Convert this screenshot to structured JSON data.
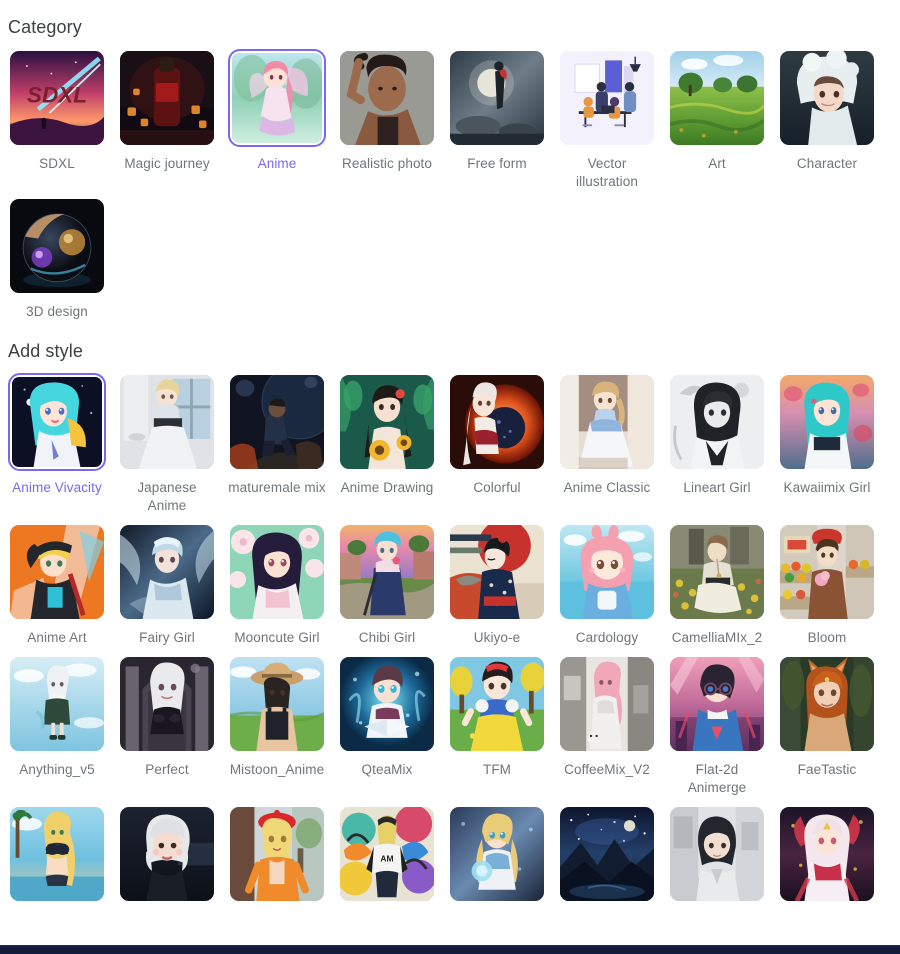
{
  "sections": {
    "category": {
      "title": "Category",
      "items": [
        {
          "label": "SDXL",
          "selected": false,
          "art": "sdxl"
        },
        {
          "label": "Magic journey",
          "selected": false,
          "art": "magic"
        },
        {
          "label": "Anime",
          "selected": true,
          "art": "anime-fairy"
        },
        {
          "label": "Realistic photo",
          "selected": false,
          "art": "realistic-portrait"
        },
        {
          "label": "Free form",
          "selected": false,
          "art": "freeform"
        },
        {
          "label": "Vector illustration",
          "selected": false,
          "art": "vector-office"
        },
        {
          "label": "Art",
          "selected": false,
          "art": "art-landscape"
        },
        {
          "label": "Character",
          "selected": false,
          "art": "character-hood"
        },
        {
          "label": "3D design",
          "selected": false,
          "art": "threed-orb"
        }
      ]
    },
    "add_style": {
      "title": "Add style",
      "items": [
        {
          "label": "Anime Vivacity",
          "selected": true,
          "art": "cyan-girl"
        },
        {
          "label": "Japanese Anime",
          "selected": false,
          "art": "window-dress"
        },
        {
          "label": "maturemale mix",
          "selected": false,
          "art": "space-man"
        },
        {
          "label": "Anime Drawing",
          "selected": false,
          "art": "sunflower-girl"
        },
        {
          "label": "Colorful",
          "selected": false,
          "art": "fire-orb"
        },
        {
          "label": "Anime Classic",
          "selected": false,
          "art": "blue-dress"
        },
        {
          "label": "Lineart Girl",
          "selected": false,
          "art": "mono-line"
        },
        {
          "label": "Kawaiimix Girl",
          "selected": false,
          "art": "kawaii-teal"
        },
        {
          "label": "Anime Art",
          "selected": false,
          "art": "orange-pop"
        },
        {
          "label": "Fairy Girl",
          "selected": false,
          "art": "icy-fairy"
        },
        {
          "label": "Mooncute Girl",
          "selected": false,
          "art": "blossom-girl"
        },
        {
          "label": "Chibi Girl",
          "selected": false,
          "art": "sunset-town"
        },
        {
          "label": "Ukiyo-e",
          "selected": false,
          "art": "ukiyo"
        },
        {
          "label": "Cardology",
          "selected": false,
          "art": "bunny-hoodie"
        },
        {
          "label": "CamelliaMIx_2",
          "selected": false,
          "art": "garden-sit"
        },
        {
          "label": "Bloom",
          "selected": false,
          "art": "market-girl"
        },
        {
          "label": "Anything_v5",
          "selected": false,
          "art": "sky-walk"
        },
        {
          "label": "Perfect",
          "selected": false,
          "art": "gothic-arch"
        },
        {
          "label": "Mistoon_Anime",
          "selected": false,
          "art": "hat-field"
        },
        {
          "label": "QteaMix",
          "selected": false,
          "art": "magic-book"
        },
        {
          "label": "TFM",
          "selected": false,
          "art": "snow-white"
        },
        {
          "label": "CoffeeMix_V2",
          "selected": false,
          "art": "pink-hall"
        },
        {
          "label": "Flat-2d Animerge",
          "selected": false,
          "art": "glasses-girl"
        },
        {
          "label": "FaeTastic",
          "selected": false,
          "art": "fox-fae"
        },
        {
          "label": "",
          "selected": false,
          "art": "beach-blonde"
        },
        {
          "label": "",
          "selected": false,
          "art": "silver-bob"
        },
        {
          "label": "",
          "selected": false,
          "art": "red-beret"
        },
        {
          "label": "",
          "selected": false,
          "art": "graffiti-wall"
        },
        {
          "label": "",
          "selected": false,
          "art": "orb-braid"
        },
        {
          "label": "",
          "selected": false,
          "art": "night-sky"
        },
        {
          "label": "",
          "selected": false,
          "art": "street-bob"
        },
        {
          "label": "",
          "selected": false,
          "art": "red-ornate"
        }
      ]
    }
  },
  "colors": {
    "accent": "#7b68ee",
    "label": "#70757a",
    "heading": "#3c4043",
    "page_background": "#ffffff",
    "bottom_bar": "#141c3a"
  }
}
